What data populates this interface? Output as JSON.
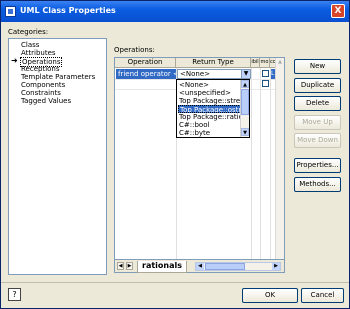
{
  "window": {
    "title": "UML Class Properties",
    "close_label": "X"
  },
  "categories": {
    "label": "Categories:",
    "items": [
      {
        "label": "Class"
      },
      {
        "label": "Attributes"
      },
      {
        "label": "Operations",
        "selected": true
      },
      {
        "label": "Receptions"
      },
      {
        "label": "Template Parameters"
      },
      {
        "label": "Components"
      },
      {
        "label": "Constraints"
      },
      {
        "label": "Tagged Values"
      }
    ]
  },
  "operations": {
    "label": "Operations:",
    "columns": [
      "Operation",
      "Return Type",
      "ibil",
      "mo",
      "cop"
    ],
    "row": {
      "operation": "friend operator <<",
      "return_type": "<None>",
      "last_cell": "L"
    },
    "dropdown_options": [
      "<None>",
      "<unspecified>",
      "Top Package::strea",
      "Top Package::ostre",
      "Top Package::ration",
      "C#::bool",
      "C#::byte"
    ],
    "dropdown_selected_index": 3,
    "sheet_tab": "rationals"
  },
  "buttons": {
    "new": "New",
    "duplicate": "Duplicate",
    "delete": "Delete",
    "move_up": "Move Up",
    "move_down": "Move Down",
    "properties": "Properties...",
    "methods": "Methods..."
  },
  "footer": {
    "help": "?",
    "ok": "OK",
    "cancel": "Cancel"
  },
  "colors": {
    "title_bar": "#0a5ce0",
    "selection": "#316ac5",
    "dialog_bg": "#ece9d8"
  }
}
